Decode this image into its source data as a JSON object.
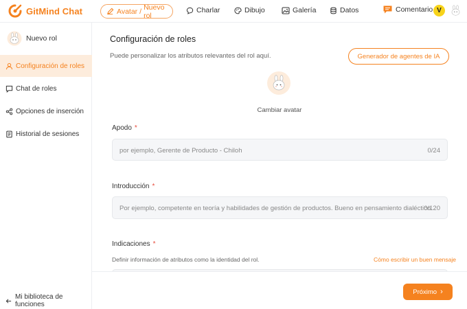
{
  "brand": {
    "name": "GitMind Chat",
    "color": "#f5821f"
  },
  "nav": {
    "active": {
      "part1": "Avatar",
      "separator": "/",
      "part2": "Nuevo rol"
    },
    "items": [
      {
        "label": "Charlar",
        "icon": "chat-bubble-icon"
      },
      {
        "label": "Dibujo",
        "icon": "palette-icon"
      },
      {
        "label": "Galería",
        "icon": "image-icon"
      },
      {
        "label": "Datos",
        "icon": "database-icon"
      }
    ],
    "comment": "Comentario",
    "vip_badge": "V"
  },
  "sidebar": {
    "role_name": "Nuevo rol",
    "items": [
      {
        "label": "Configuración de roles",
        "icon": "user-icon",
        "active": true
      },
      {
        "label": "Chat de roles",
        "icon": "chat-square-icon",
        "active": false
      },
      {
        "label": "Opciones de inserción",
        "icon": "share-icon",
        "active": false
      },
      {
        "label": "Historial de sesiones",
        "icon": "document-icon",
        "active": false
      }
    ],
    "bottom": "Mi biblioteca de funciones"
  },
  "main": {
    "title": "Configuración de roles",
    "subtitle": "Puede personalizar los atributos relevantes del rol aquí.",
    "ai_button": "Generador de agentes de IA",
    "change_avatar": "Cambiar avatar",
    "fields": {
      "name": {
        "label": "Apodo",
        "required": "*",
        "placeholder": "por ejemplo, Gerente de Producto - Chiloh",
        "count": "0/24"
      },
      "intro": {
        "label": "Introducción",
        "required": "*",
        "placeholder": "Por ejemplo, competente en teoría y habilidades de gestión de productos. Bueno en pensamiento dialéctico.",
        "count": "0/120"
      },
      "prompt": {
        "label": "Indicaciones",
        "required": "*",
        "hint": "Definir información de atributos como la identidad del rol.",
        "link": "Cómo escribir un buen mensaje"
      }
    },
    "next_button": "Próximo",
    "next_chevron": "›"
  },
  "colors": {
    "accent": "#f5821f",
    "active_bg": "#fdecdc",
    "vip": "#f7d31a"
  }
}
